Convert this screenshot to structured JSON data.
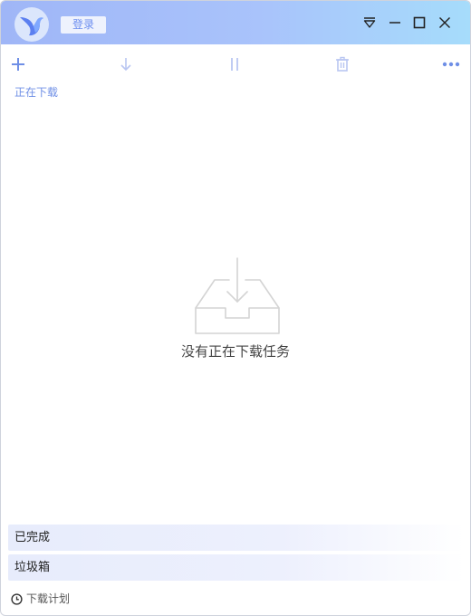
{
  "titlebar": {
    "login_label": "登录"
  },
  "toolbar": {
    "add_icon": "plus-icon",
    "start_icon": "download-arrow-icon",
    "pause_icon": "pause-icon",
    "delete_icon": "trash-icon",
    "more_icon": "more-dots-icon"
  },
  "downloading": {
    "title": "正在下载",
    "empty_text": "没有正在下载任务"
  },
  "sections": {
    "completed_label": "已完成",
    "trash_label": "垃圾箱"
  },
  "footer": {
    "schedule_label": "下载计划"
  },
  "colors": {
    "accent": "#6f8fe6",
    "titlebar_start": "#9fb6f7",
    "titlebar_end": "#a6dcfb"
  }
}
